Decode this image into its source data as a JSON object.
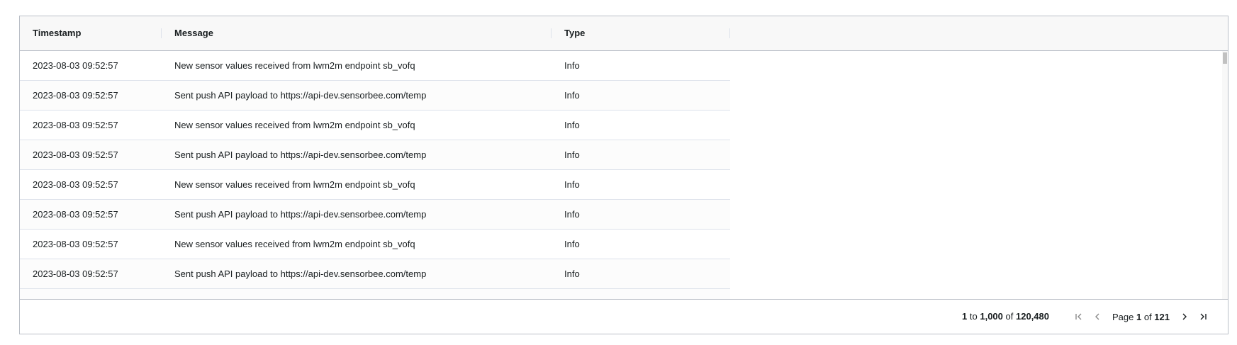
{
  "columns": {
    "timestamp": "Timestamp",
    "message": "Message",
    "type": "Type"
  },
  "rows": [
    {
      "timestamp": "2023-08-03 09:52:57",
      "message": "New sensor values received from lwm2m endpoint sb_vofq",
      "type": "Info"
    },
    {
      "timestamp": "2023-08-03 09:52:57",
      "message": "Sent push API payload to https://api-dev.sensorbee.com/temp",
      "type": "Info"
    },
    {
      "timestamp": "2023-08-03 09:52:57",
      "message": "New sensor values received from lwm2m endpoint sb_vofq",
      "type": "Info"
    },
    {
      "timestamp": "2023-08-03 09:52:57",
      "message": "Sent push API payload to https://api-dev.sensorbee.com/temp",
      "type": "Info"
    },
    {
      "timestamp": "2023-08-03 09:52:57",
      "message": "New sensor values received from lwm2m endpoint sb_vofq",
      "type": "Info"
    },
    {
      "timestamp": "2023-08-03 09:52:57",
      "message": "Sent push API payload to https://api-dev.sensorbee.com/temp",
      "type": "Info"
    },
    {
      "timestamp": "2023-08-03 09:52:57",
      "message": "New sensor values received from lwm2m endpoint sb_vofq",
      "type": "Info"
    },
    {
      "timestamp": "2023-08-03 09:52:57",
      "message": "Sent push API payload to https://api-dev.sensorbee.com/temp",
      "type": "Info"
    }
  ],
  "footer": {
    "range_start": "1",
    "to_label": "to",
    "range_end": "1,000",
    "of_label": "of",
    "total": "120,480",
    "page_label": "Page",
    "page_current": "1",
    "page_of_label": "of",
    "page_total": "121"
  },
  "icons": {
    "first": "first-page-icon",
    "prev": "previous-page-icon",
    "next": "next-page-icon",
    "last": "last-page-icon"
  },
  "colors": {
    "border": "#babfc7",
    "header_bg": "#f8f8f8",
    "row_divider": "#dde2eb",
    "disabled_icon": "#8a8a8a",
    "active_icon": "#181d1f"
  }
}
